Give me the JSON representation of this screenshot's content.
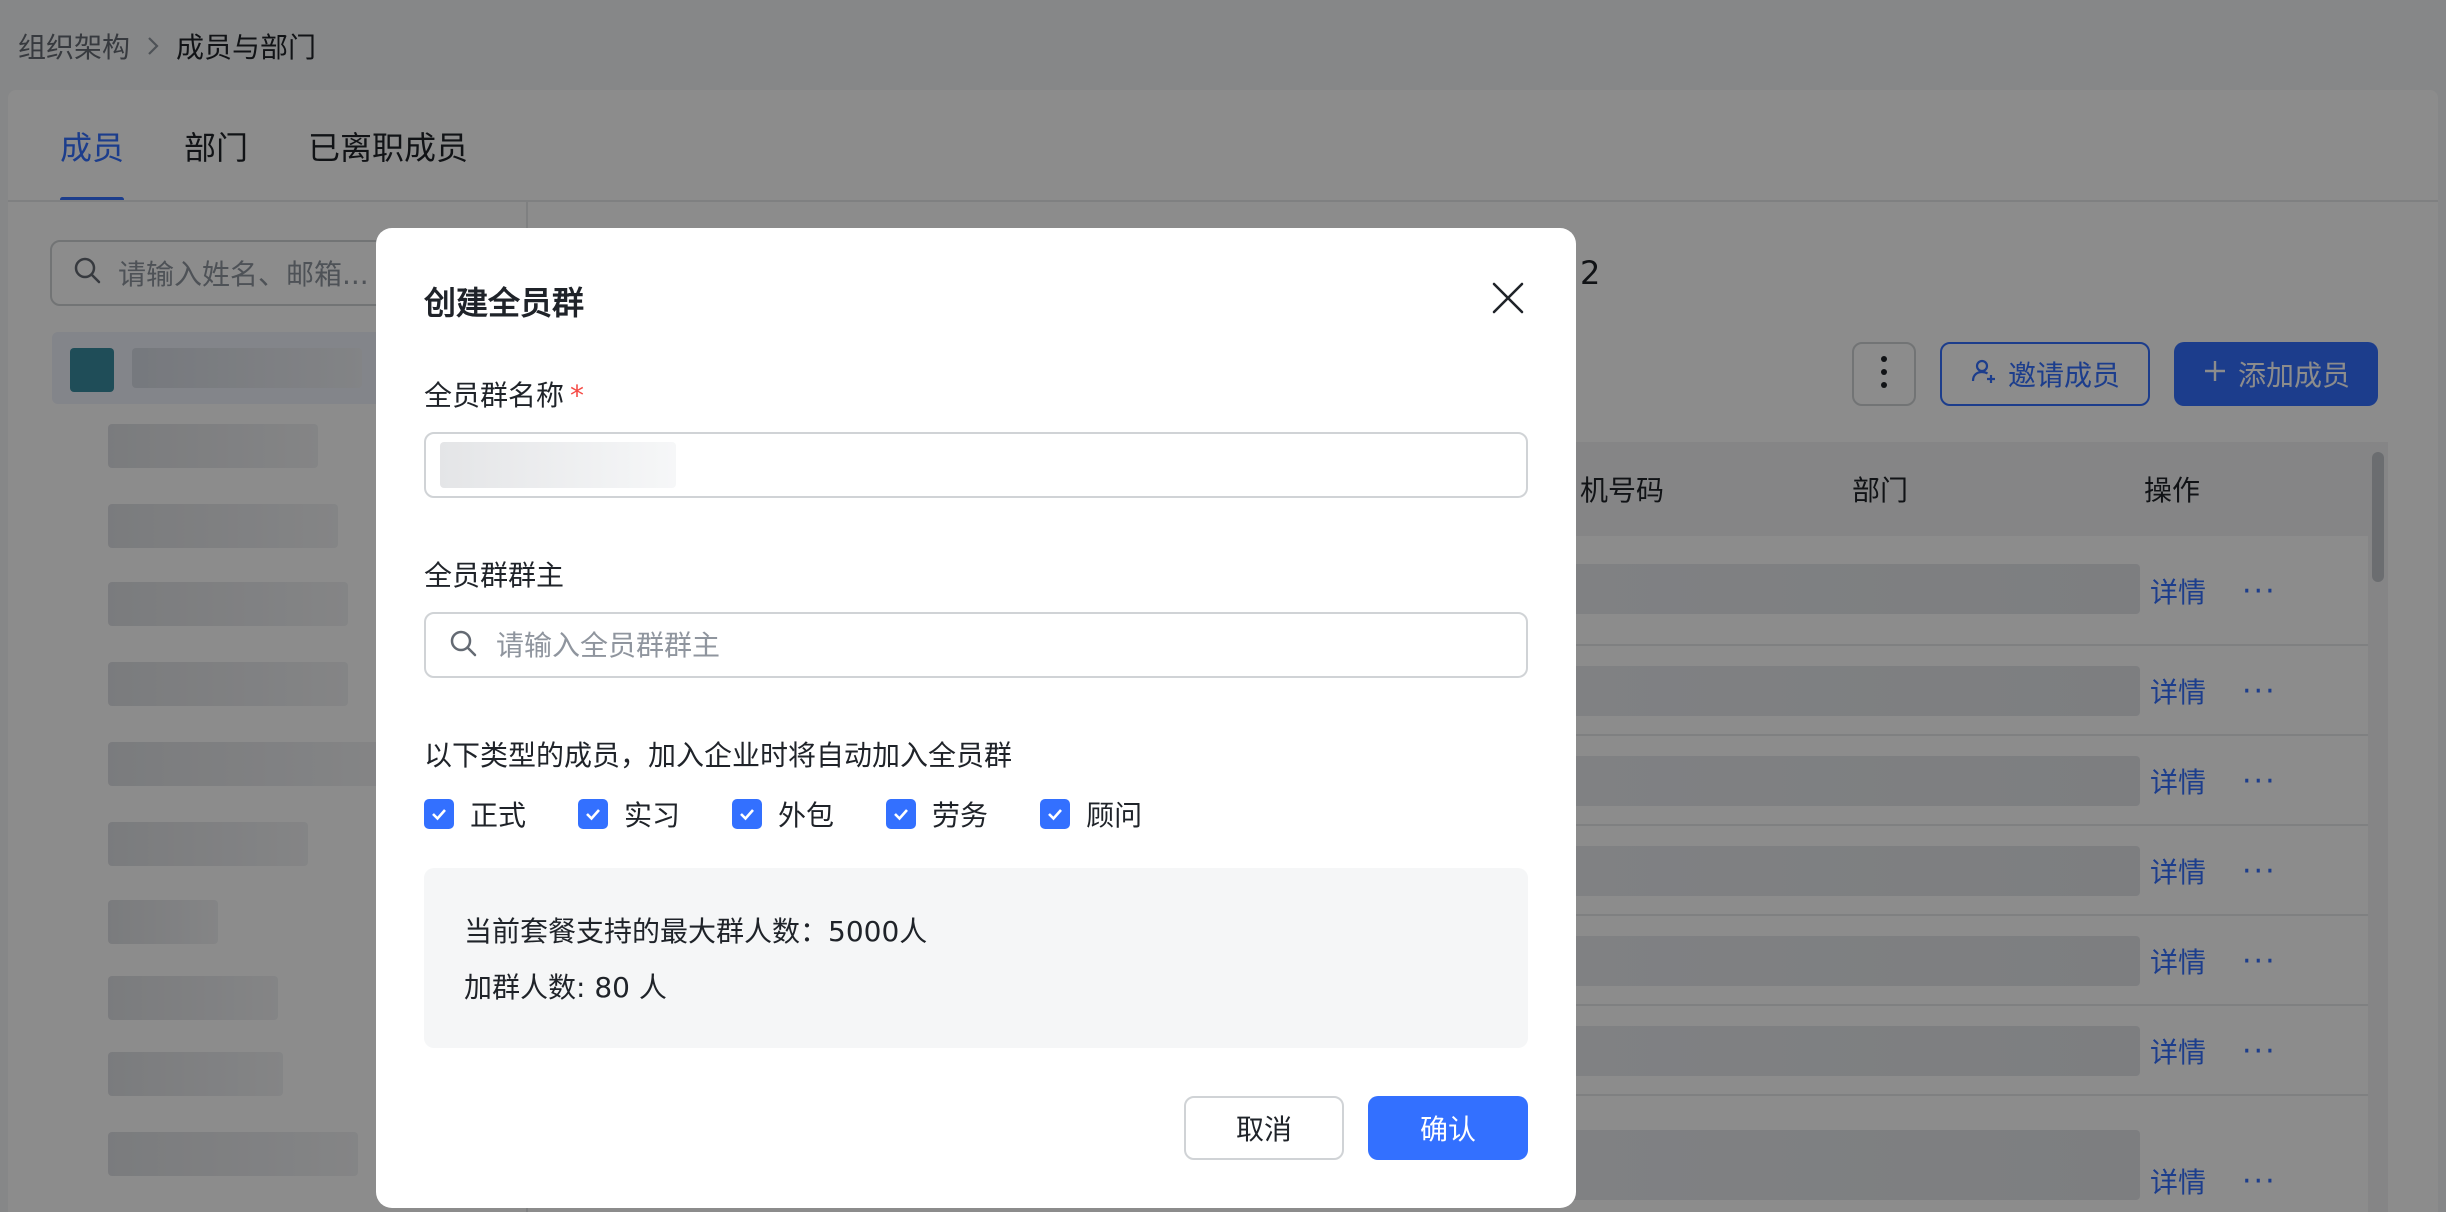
{
  "breadcrumb": {
    "parent": "组织架构",
    "current": "成员与部门"
  },
  "tabs": [
    {
      "label": "成员",
      "active": true
    },
    {
      "label": "部门",
      "active": false
    },
    {
      "label": "已离职成员",
      "active": false
    }
  ],
  "member_search": {
    "placeholder": "请输入姓名、邮箱..."
  },
  "right_panel": {
    "count_suffix": "2"
  },
  "toolbar": {
    "invite_label": "邀请成员",
    "add_label": "添加成员"
  },
  "table": {
    "columns": {
      "phone": "机号码",
      "department": "部门",
      "actions": "操作"
    },
    "rows": [
      {
        "detail": "详情",
        "more": "···"
      },
      {
        "detail": "详情",
        "more": "···"
      },
      {
        "detail": "详情",
        "more": "···"
      },
      {
        "detail": "详情",
        "more": "···"
      },
      {
        "detail": "详情",
        "more": "···"
      },
      {
        "detail": "详情",
        "more": "···"
      },
      {
        "detail": "详情",
        "more": "···"
      }
    ]
  },
  "modal": {
    "title": "创建全员群",
    "name_label": "全员群名称",
    "required_mark": "*",
    "owner_label": "全员群群主",
    "owner_placeholder": "请输入全员群群主",
    "hint": "以下类型的成员，加入企业时将自动加入全员群",
    "member_types": [
      {
        "label": "正式",
        "checked": true
      },
      {
        "label": "实习",
        "checked": true
      },
      {
        "label": "外包",
        "checked": true
      },
      {
        "label": "劳务",
        "checked": true
      },
      {
        "label": "顾问",
        "checked": true
      }
    ],
    "info_max": "当前套餐支持的最大群人数：5000人",
    "info_count": "加群人数: 80 人",
    "cancel_label": "取消",
    "confirm_label": "确认"
  },
  "colors": {
    "primary": "#3370ff",
    "required": "#f54a45",
    "overlay": "rgba(0,0,0,0.45)"
  }
}
